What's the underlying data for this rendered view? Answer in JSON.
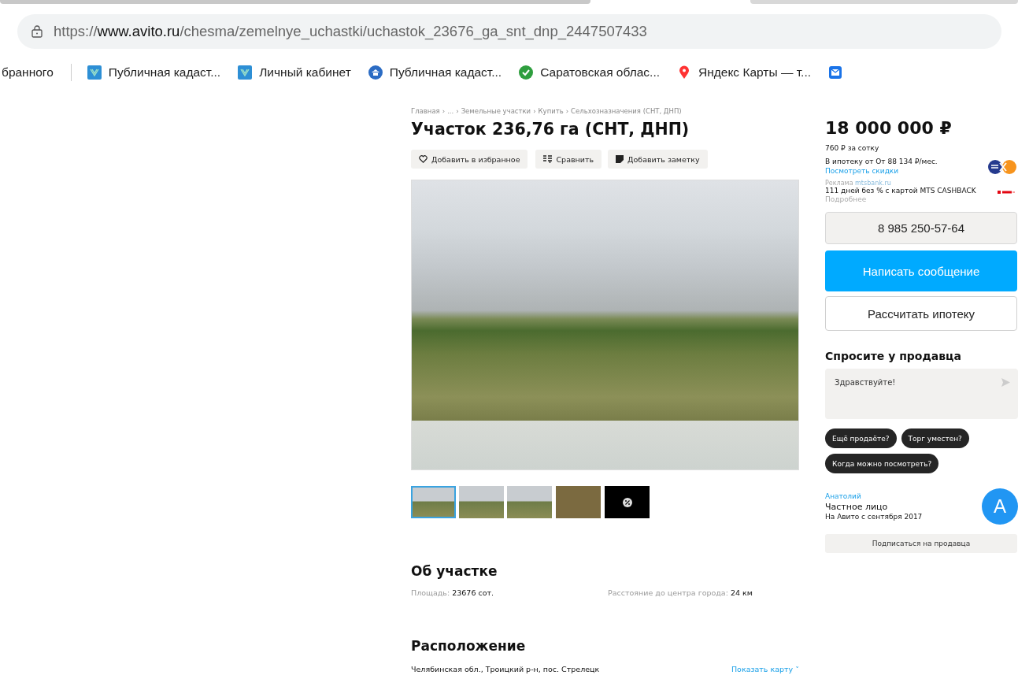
{
  "browser": {
    "url": "https://**www.avito.ru**/chesma/zemelnye_uchastki/uchastok_23676_ga_snt_dnp_2447507433",
    "bookmarks": [
      {
        "kind": "text",
        "label": "бранного"
      },
      {
        "kind": "separator"
      },
      {
        "kind": "gosuslugi",
        "label": "Публичная кадаст..."
      },
      {
        "kind": "gosuslugi",
        "label": "Личный кабинет"
      },
      {
        "kind": "home",
        "label": "Публичная кадаст..."
      },
      {
        "kind": "check",
        "label": "Саратовская облас..."
      },
      {
        "kind": "pin",
        "label": "Яндекс Карты — т..."
      },
      {
        "kind": "mail"
      }
    ]
  },
  "breadcrumbs": {
    "separator": "›",
    "items": [
      "Главная",
      "...",
      "Земельные участки",
      "Купить",
      "Сельхозназначения (СНТ, ДНП)"
    ]
  },
  "title": "Участок 236,76 га (СНТ, ДНП)",
  "actions": [
    {
      "kind": "heart",
      "label": "Добавить в избранное"
    },
    {
      "kind": "compare",
      "label": "Сравнить"
    },
    {
      "kind": "note",
      "label": "Добавить заметку"
    }
  ],
  "thumbnails": [
    {
      "kind": "field",
      "selected": true
    },
    {
      "kind": "field",
      "selected": false
    },
    {
      "kind": "field",
      "selected": false
    },
    {
      "kind": "plan",
      "selected": false
    },
    {
      "kind": "badge",
      "selected": false
    }
  ],
  "about": {
    "heading": "Об участке",
    "params": [
      {
        "label": "Площадь:",
        "value": "23676 сот."
      },
      {
        "label": "Расстояние до центра города:",
        "value": "24 км"
      }
    ]
  },
  "location": {
    "heading": "Расположение",
    "address": "Челябинская обл., Троицкий р-н, пос. Стрелецк",
    "map_link": "Показать карту ˅"
  },
  "price": {
    "amount": "18 000 000 ₽",
    "per_unit": "760 ₽ за сотку",
    "mortgage": "В ипотеку от От 88 134 ₽/мес.",
    "discounts_link": "Посмотреть скидки"
  },
  "ad": {
    "label": "Реклама",
    "domain": "mtsbank.ru",
    "text": "111 дней без % с картой MTS CASHBACK",
    "more": "Подробнее"
  },
  "phone": "8 985 250-57-64",
  "write_button": "Написать сообщение",
  "mortgage_button": "Рассчитать ипотеку",
  "ask": {
    "heading": "Спросите у продавца",
    "message": "Здравствуйте!",
    "chips": [
      "Ещё продаёте?",
      "Торг уместен?",
      "Когда можно посмотреть?"
    ]
  },
  "seller": {
    "name": "Анатолий",
    "type": "Частное лицо",
    "since": "На Авито с сентября 2017",
    "avatar_letter": "A",
    "subscribe": "Подписаться на продавца"
  }
}
